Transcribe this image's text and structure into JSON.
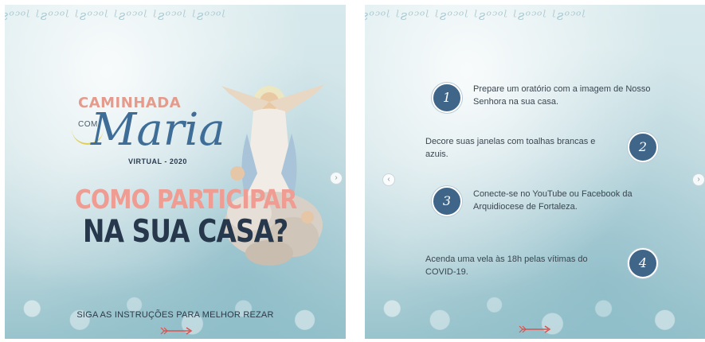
{
  "slide1": {
    "border_text": "ᶩƨᵒᵓᵒᶩ ᶩƨᵒᵓᵒᶩ ᶩƨᵒᵓᵒᶩ ᶩƨᵒᵓᵒᶩ ᶩƨᵒᵓᵒᶩ ᶩƨᵒᵓᵒᶩ",
    "title_top": "CAMINHADA",
    "title_com": "COM",
    "title_maria": "Maria",
    "title_virtual": "VIRTUAL - 2020",
    "headline_1": "COMO PARTICIPAR",
    "headline_2": "NA SUA CASA?",
    "footer": "SIGA AS INSTRUÇÕES PARA MELHOR REZAR",
    "next_glyph": "›"
  },
  "slide2": {
    "border_text": "ᶩƨᵒᵓᵒᶩ ᶩƨᵒᵓᵒᶩ ᶩƨᵒᵓᵒᶩ ᶩƨᵒᵓᵒᶩ ᶩƨᵒᵓᵒᶩ ᶩƨᵒᵓᵒᶩ",
    "prev_glyph": "‹",
    "next_glyph": "›",
    "steps": [
      {
        "number": "1",
        "text": "Prepare um oratório com a imagem de Nosso Senhora na sua casa."
      },
      {
        "number": "2",
        "text": "Decore suas janelas com toalhas brancas e azuis."
      },
      {
        "number": "3",
        "text": "Conecte-se no YouTube ou Facebook da Arquidiocese de Fortaleza."
      },
      {
        "number": "4",
        "text": "Acenda uma vela às 18h pelas vítimas do COVID-19."
      }
    ]
  },
  "colors": {
    "accent_blue": "#3f6588",
    "pink": "#ef9c92",
    "navy": "#27384d",
    "arrow_red": "#d9534f"
  }
}
